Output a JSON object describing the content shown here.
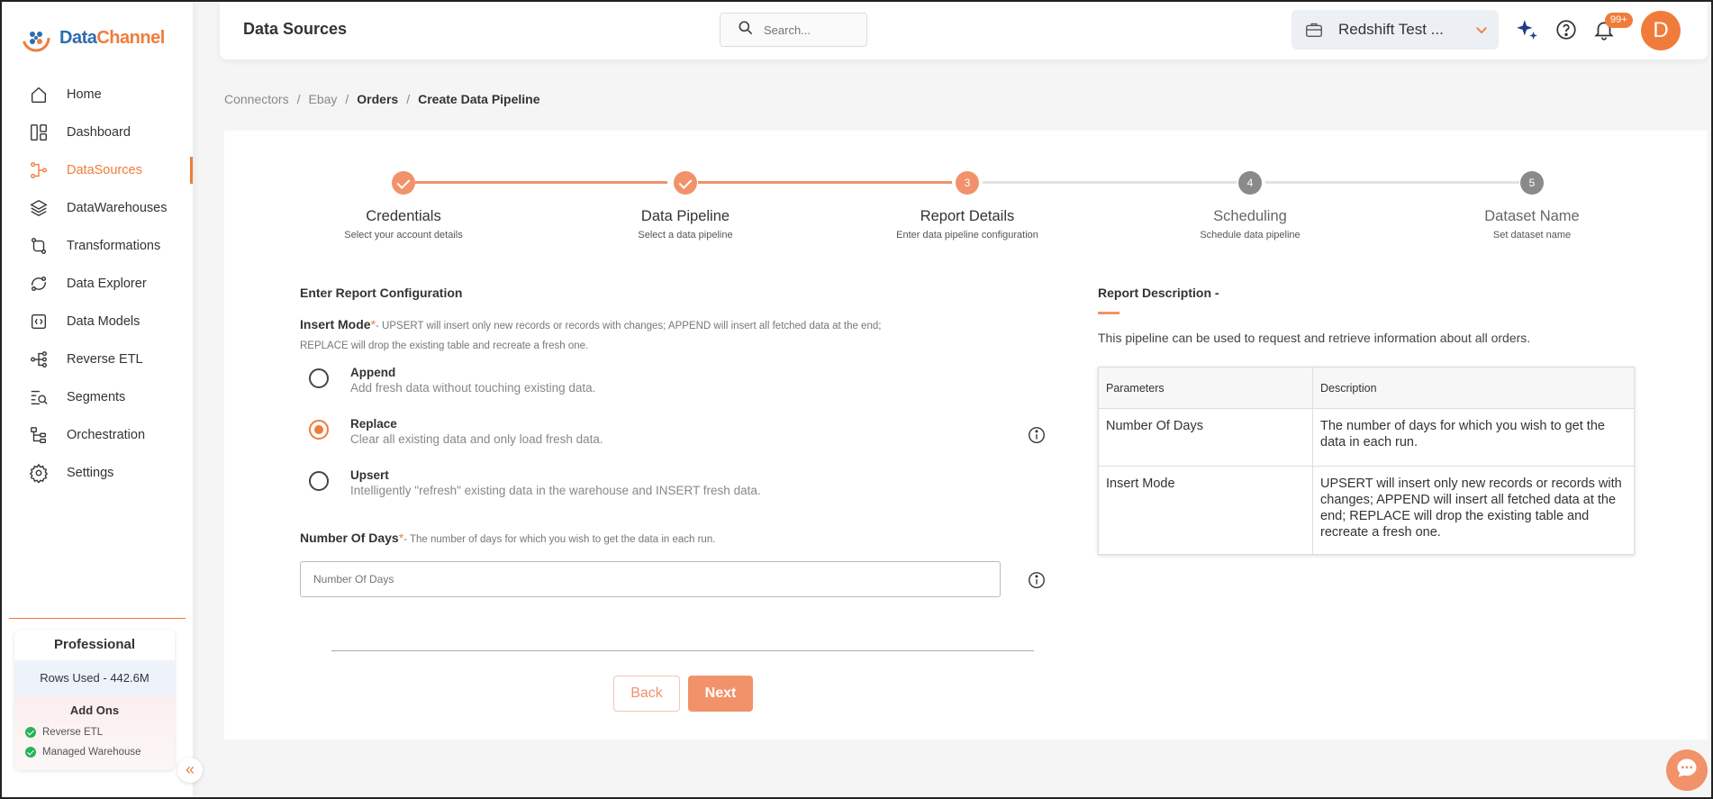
{
  "app": {
    "logo_text_a": "Data",
    "logo_text_b": "Channel",
    "accent_color": "#f07c3b"
  },
  "sidebar": {
    "items": [
      {
        "label": "Home",
        "icon": "home-icon",
        "active": false
      },
      {
        "label": "Dashboard",
        "icon": "dashboard-icon",
        "active": false
      },
      {
        "label": "DataSources",
        "icon": "datasources-icon",
        "active": true
      },
      {
        "label": "DataWarehouses",
        "icon": "layers-icon",
        "active": false
      },
      {
        "label": "Transformations",
        "icon": "transform-icon",
        "active": false
      },
      {
        "label": "Data Explorer",
        "icon": "explorer-icon",
        "active": false
      },
      {
        "label": "Data Models",
        "icon": "models-icon",
        "active": false
      },
      {
        "label": "Reverse ETL",
        "icon": "reverse-etl-icon",
        "active": false
      },
      {
        "label": "Segments",
        "icon": "segments-icon",
        "active": false
      },
      {
        "label": "Orchestration",
        "icon": "orchestration-icon",
        "active": false
      },
      {
        "label": "Settings",
        "icon": "gear-icon",
        "active": false
      }
    ],
    "plan": {
      "name": "Professional",
      "rows_used": "Rows Used - 442.6M",
      "addons_title": "Add Ons",
      "addons": [
        "Reverse ETL",
        "Managed Warehouse"
      ]
    },
    "collapse_glyph": "«"
  },
  "header": {
    "title": "Data Sources",
    "search_placeholder": "Search...",
    "workspace": "Redshift Test ...",
    "notification_count": "99+",
    "avatar_initial": "D"
  },
  "breadcrumb": [
    "Connectors",
    "Ebay",
    "Orders",
    "Create Data Pipeline"
  ],
  "stepper": [
    {
      "num": "1",
      "title": "Credentials",
      "sub": "Select your account details",
      "state": "done"
    },
    {
      "num": "2",
      "title": "Data Pipeline",
      "sub": "Select a data pipeline",
      "state": "done"
    },
    {
      "num": "3",
      "title": "Report Details",
      "sub": "Enter data pipeline configuration",
      "state": "current"
    },
    {
      "num": "4",
      "title": "Scheduling",
      "sub": "Schedule data pipeline",
      "state": "todo"
    },
    {
      "num": "5",
      "title": "Dataset Name",
      "sub": "Set dataset name",
      "state": "todo"
    }
  ],
  "form": {
    "section_title": "Enter Report Configuration",
    "insert_mode_label": "Insert Mode",
    "required_mark": "*",
    "insert_mode_help": "- UPSERT will insert only new records or records with changes; APPEND will insert all fetched data at the end;",
    "insert_mode_help_2": "REPLACE will drop the existing table and recreate a fresh one.",
    "options": [
      {
        "title": "Append",
        "desc": "Add fresh data without touching existing data.",
        "checked": false
      },
      {
        "title": "Replace",
        "desc": "Clear all existing data and only load fresh data.",
        "checked": true
      },
      {
        "title": "Upsert",
        "desc": "Intelligently \"refresh\" existing data in the warehouse and INSERT fresh data.",
        "checked": false
      }
    ],
    "days_label": "Number Of Days",
    "days_help": "- The number of days for which you wish to get the data in each run.",
    "days_placeholder": "Number Of Days",
    "back_label": "Back",
    "next_label": "Next"
  },
  "report": {
    "title": "Report Description -",
    "desc": "This pipeline can be used to request and retrieve information about all orders.",
    "headers": [
      "Parameters",
      "Description"
    ],
    "rows": [
      {
        "param": "Number Of Days",
        "desc": "The number of days for which you wish to get the data in each run."
      },
      {
        "param": "Insert Mode",
        "desc": "UPSERT will insert only new records or records with changes; APPEND will insert all fetched data at the end; REPLACE will drop the existing table and recreate a fresh one."
      }
    ]
  }
}
